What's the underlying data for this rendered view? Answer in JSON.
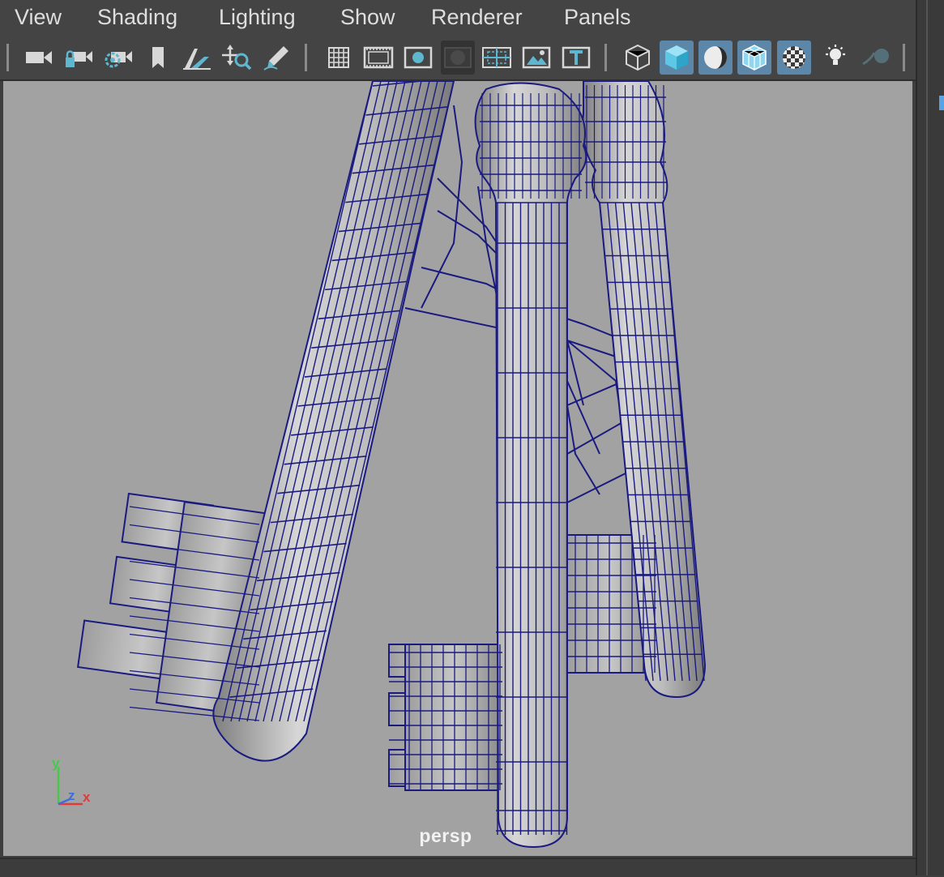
{
  "menu": {
    "items": [
      {
        "label": "View"
      },
      {
        "label": "Shading"
      },
      {
        "label": "Lighting"
      },
      {
        "label": "Show"
      },
      {
        "label": "Renderer"
      },
      {
        "label": "Panels"
      }
    ]
  },
  "toolbar": {
    "buttons": [
      {
        "icon": "select-camera-icon"
      },
      {
        "icon": "lock-camera-icon"
      },
      {
        "icon": "camera-attributes-icon"
      },
      {
        "icon": "bookmark-icon"
      },
      {
        "icon": "image-plane-icon"
      },
      {
        "icon": "2d-pan-zoom-icon"
      },
      {
        "icon": "grease-pencil-icon"
      },
      {
        "icon": "grid-icon"
      },
      {
        "icon": "film-gate-icon"
      },
      {
        "icon": "resolution-gate-icon"
      },
      {
        "icon": "gate-mask-icon"
      },
      {
        "icon": "field-chart-icon"
      },
      {
        "icon": "safe-action-icon"
      },
      {
        "icon": "safe-title-icon"
      },
      {
        "icon": "wireframe-icon"
      },
      {
        "icon": "smooth-shade-icon"
      },
      {
        "icon": "default-lighting-icon"
      },
      {
        "icon": "wireframe-on-shaded-icon"
      },
      {
        "icon": "textured-icon"
      },
      {
        "icon": "use-all-lights-icon"
      },
      {
        "icon": "shadows-icon"
      }
    ],
    "active_states": [
      "smooth-shade",
      "default-lighting",
      "wireframe-on-shaded",
      "textured"
    ],
    "accent_color": "#5d87a9"
  },
  "viewport": {
    "camera_label": "persp",
    "background_color": "#a2a2a2",
    "wire_color": "#1a1a80",
    "axis": {
      "y": "y",
      "z": "z",
      "x": "x"
    }
  }
}
